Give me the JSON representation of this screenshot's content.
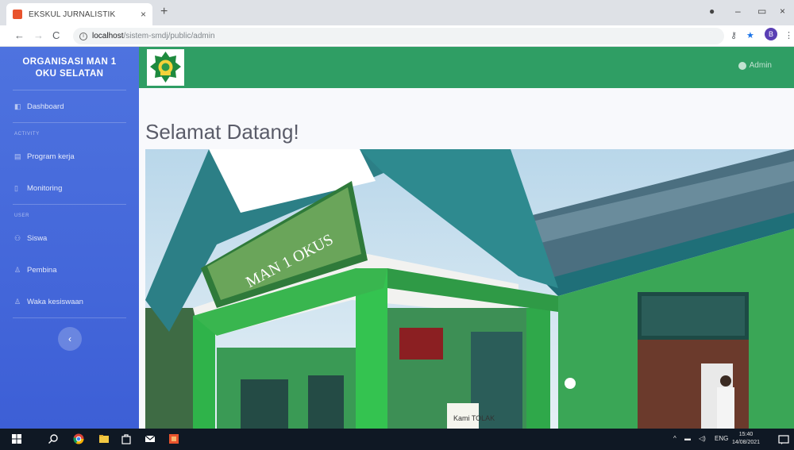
{
  "browser": {
    "tab_title": "EKSKUL JURNALISTIK",
    "tab_close": "×",
    "new_tab": "+",
    "url_host": "localhost",
    "url_path": "/sistem-smdj/public/admin",
    "profile_initial": "B",
    "window_controls": {
      "minimize": "–",
      "maximize": "▭",
      "close": "×"
    },
    "nav": {
      "back": "←",
      "forward": "→",
      "reload": "C"
    }
  },
  "sidebar": {
    "brand": "ORGANISASI MAN 1 OKU SELATAN",
    "dashboard": "Dashboard",
    "heading_activity": "ACTIVITY",
    "program_kerja": "Program kerja",
    "monitoring": "Monitoring",
    "heading_users": "USER",
    "siswa": "Siswa",
    "pembina": "Pembina",
    "waka": "Waka kesiswaan",
    "toggle": "‹"
  },
  "topbar": {
    "user_label": "Admin"
  },
  "main": {
    "greeting": "Selamat Datang!",
    "photo_sign": "MAN 1 OKUS",
    "photo_sign2": "Kami TOLAK"
  },
  "taskbar": {
    "lang": "ENG",
    "time": "15:40",
    "date": "14/08/2021"
  },
  "colors": {
    "sidebar": "#4e73df",
    "topbar": "#2f9e64",
    "heading_text": "#5a5c69"
  }
}
